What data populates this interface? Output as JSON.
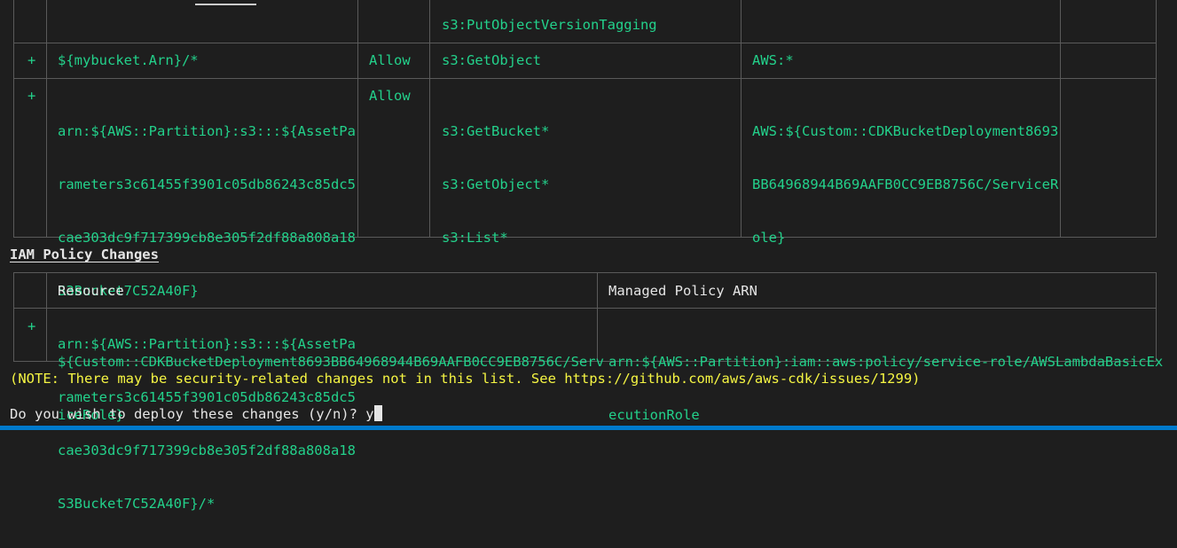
{
  "statement_table": {
    "rows": [
      {
        "sign": "",
        "resource": [
          ""
        ],
        "effect": "",
        "action": [
          "s3:PutObjectVersionTagging"
        ],
        "principal": [
          ""
        ],
        "condition": ""
      },
      {
        "sign": "+",
        "resource": [
          "${mybucket.Arn}/*"
        ],
        "effect": "Allow",
        "action": [
          "s3:GetObject"
        ],
        "principal": [
          "AWS:*"
        ],
        "condition": ""
      },
      {
        "sign": "+",
        "resource": [
          "arn:${AWS::Partition}:s3:::${AssetPa",
          "rameters3c61455f3901c05db86243c85dc5",
          "cae303dc9f717399cb8e305f2df88a808a18",
          "S3Bucket7C52A40F}",
          "arn:${AWS::Partition}:s3:::${AssetPa",
          "rameters3c61455f3901c05db86243c85dc5",
          "cae303dc9f717399cb8e305f2df88a808a18",
          "S3Bucket7C52A40F}/*"
        ],
        "effect": "Allow",
        "action": [
          "s3:GetBucket*",
          "s3:GetObject*",
          "s3:List*"
        ],
        "principal": [
          "AWS:${Custom::CDKBucketDeployment8693",
          "BB64968944B69AAFB0CC9EB8756C/ServiceR",
          "ole}"
        ],
        "condition": ""
      }
    ]
  },
  "iam_policy": {
    "heading": "IAM Policy Changes",
    "headers": {
      "sign": "",
      "resource": "Resource",
      "arn": "Managed Policy ARN"
    },
    "rows": [
      {
        "sign": "+",
        "resource": [
          "${Custom::CDKBucketDeployment8693BB64968944B69AAFB0CC9EB8756C/Serv",
          "iceRole}"
        ],
        "arn": [
          "arn:${AWS::Partition}:iam::aws:policy/service-role/AWSLambdaBasicEx",
          "ecutionRole"
        ]
      }
    ]
  },
  "note": "(NOTE: There may be security-related changes not in this list. See https://github.com/aws/aws-cdk/issues/1299)",
  "prompt": {
    "question": "Do you wish to deploy these changes (y/n)? ",
    "answer": "y"
  },
  "colors": {
    "background": "#1e1e1e",
    "added": "#23d18b",
    "note": "#f5f543",
    "text": "#e5e5e5",
    "border": "#5a5a5a",
    "status_bar": "#007acc"
  }
}
